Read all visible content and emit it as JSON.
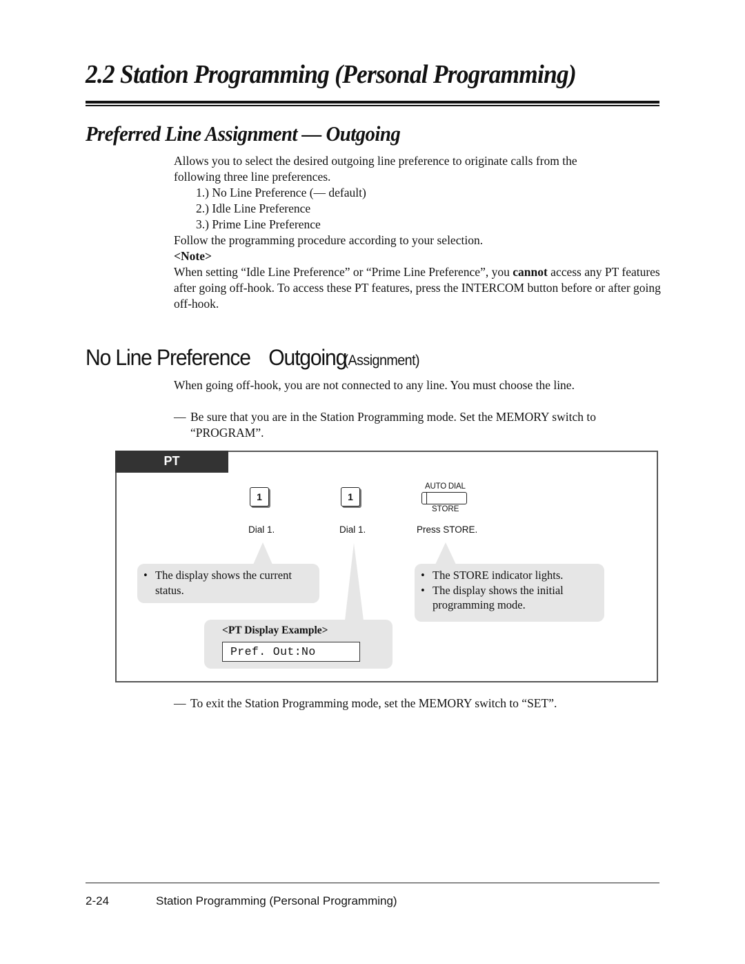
{
  "header": {
    "chapter_title": "2.2  Station Programming (Personal Programming)"
  },
  "section": {
    "title": "Preferred Line Assignment — Outgoing",
    "intro_lines": [
      "Allows you to select the desired outgoing line preference to originate calls from the",
      "following three line preferences."
    ],
    "options": [
      "1.) No Line Preference (— default)",
      "2.) Idle Line Preference",
      "3.) Prime Line Preference"
    ],
    "follow_text": "Follow the programming procedure according to your selection.",
    "note_label": "<Note>",
    "note_pre": "When setting “Idle Line Preference” or “Prime Line Preference”, you ",
    "note_bold": "cannot",
    "note_post": " access any PT features after going off-hook. To access these PT features, press the INTERCOM button before or after going off-hook."
  },
  "subsection": {
    "title_main": "No Line Preference",
    "title_part2": "Outgoing",
    "title_small": "(Assignment)",
    "description": "When going off-hook, you are not connected to any line. You must choose the line.",
    "pre_step_dash": "—",
    "pre_step_line1": "Be sure that you are in the Station Programming mode. Set the MEMORY switch to",
    "pre_step_line2": "“PROGRAM”.",
    "post_step_dash": "—",
    "post_step": "To exit the Station Programming mode, set the MEMORY switch to “SET”."
  },
  "diagram": {
    "tab_label": "PT",
    "steps": [
      {
        "key_label": "1",
        "caption": "Dial 1."
      },
      {
        "key_label": "1",
        "caption": "Dial 1."
      },
      {
        "button_top_label": "AUTO DIAL",
        "button_bottom_label": "STORE",
        "caption": "Press STORE."
      }
    ],
    "callout_left": {
      "bullet": "•",
      "items": [
        "The display shows the current status."
      ]
    },
    "callout_right": {
      "bullet": "•",
      "items": [
        "The STORE indicator lights.",
        "The display shows the initial programming mode."
      ]
    },
    "display_example": {
      "label": "<PT Display Example>",
      "value": "Pref. Out:No"
    },
    "colors": {
      "tab_bg": "#333333",
      "callout_bg": "#e6e6e6",
      "frame": "#555555"
    }
  },
  "footer": {
    "page_number": "2-24",
    "title": "Station Programming (Personal Programming)"
  }
}
